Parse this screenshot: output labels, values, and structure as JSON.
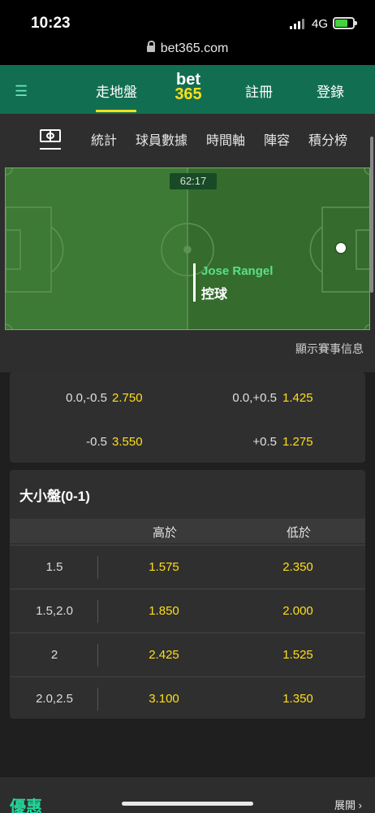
{
  "status_bar": {
    "time": "10:23",
    "network": "4G"
  },
  "browser": {
    "url": "bet365.com"
  },
  "nav": {
    "active_tab": "走地盤",
    "logo_top": "bet",
    "logo_bottom": "365",
    "register": "註冊",
    "login": "登錄"
  },
  "sub_tabs": [
    "統計",
    "球員數據",
    "時間軸",
    "陣容",
    "積分榜"
  ],
  "match": {
    "clock": "62:17",
    "player": "Jose Rangel",
    "action": "控球",
    "show_info": "顯示賽事信息"
  },
  "handicap": [
    {
      "left_label": "0.0,-0.5",
      "left_odds": "2.750",
      "right_label": "0.0,+0.5",
      "right_odds": "1.425"
    },
    {
      "left_label": "-0.5",
      "left_odds": "3.550",
      "right_label": "+0.5",
      "right_odds": "1.275"
    }
  ],
  "over_under": {
    "title": "大小盤(0-1)",
    "over_header": "高於",
    "under_header": "低於",
    "rows": [
      {
        "line": "1.5",
        "over": "1.575",
        "under": "2.350"
      },
      {
        "line": "1.5,2.0",
        "over": "1.850",
        "under": "2.000"
      },
      {
        "line": "2",
        "over": "2.425",
        "under": "1.525"
      },
      {
        "line": "2.0,2.5",
        "over": "3.100",
        "under": "1.350"
      }
    ]
  },
  "bottom": {
    "promo": "優惠",
    "expand": "展開 ›"
  },
  "colors": {
    "brand_green": "#126e51",
    "accent_yellow": "#ffdf1b",
    "pitch_green": "#3d7a35",
    "promo_green": "#22d69a"
  }
}
